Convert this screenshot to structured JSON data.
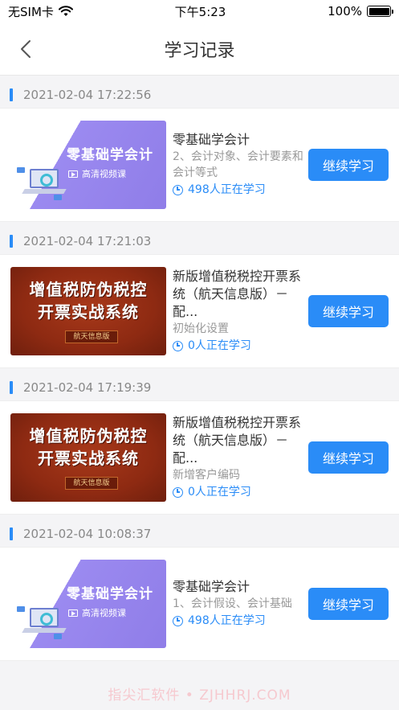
{
  "status": {
    "carrier": "无SIM卡",
    "time": "下午5:23",
    "battery": "100%",
    "battery_level": 1.0
  },
  "nav": {
    "title": "学习记录"
  },
  "records": [
    {
      "date": "2021-02-04 17:22:56",
      "thumb": "purple",
      "thumb_title": "零基础学会计",
      "thumb_sub": "高清视频课",
      "title": "零基础学会计",
      "lesson": "2、会计对象、会计要素和会计等式",
      "count": "498人正在学习",
      "button": "继续学习"
    },
    {
      "date": "2021-02-04 17:21:03",
      "thumb": "red",
      "thumb_line1": "增值税防伪税控",
      "thumb_line2": "开票实战系统",
      "thumb_tag": "航天信息版",
      "title": "新版增值税税控开票系统（航天信息版）－配...",
      "lesson": "初始化设置",
      "count": "0人正在学习",
      "button": "继续学习"
    },
    {
      "date": "2021-02-04 17:19:39",
      "thumb": "red",
      "thumb_line1": "增值税防伪税控",
      "thumb_line2": "开票实战系统",
      "thumb_tag": "航天信息版",
      "title": "新版增值税税控开票系统（航天信息版）－配...",
      "lesson": "新增客户编码",
      "count": "0人正在学习",
      "button": "继续学习"
    },
    {
      "date": "2021-02-04 10:08:37",
      "thumb": "purple",
      "thumb_title": "零基础学会计",
      "thumb_sub": "高清视频课",
      "title": "零基础学会计",
      "lesson": "1、会计假设、会计基础",
      "count": "498人正在学习",
      "button": "继续学习"
    }
  ],
  "watermark": "指尖汇软件 • ZJHHRJ.COM"
}
